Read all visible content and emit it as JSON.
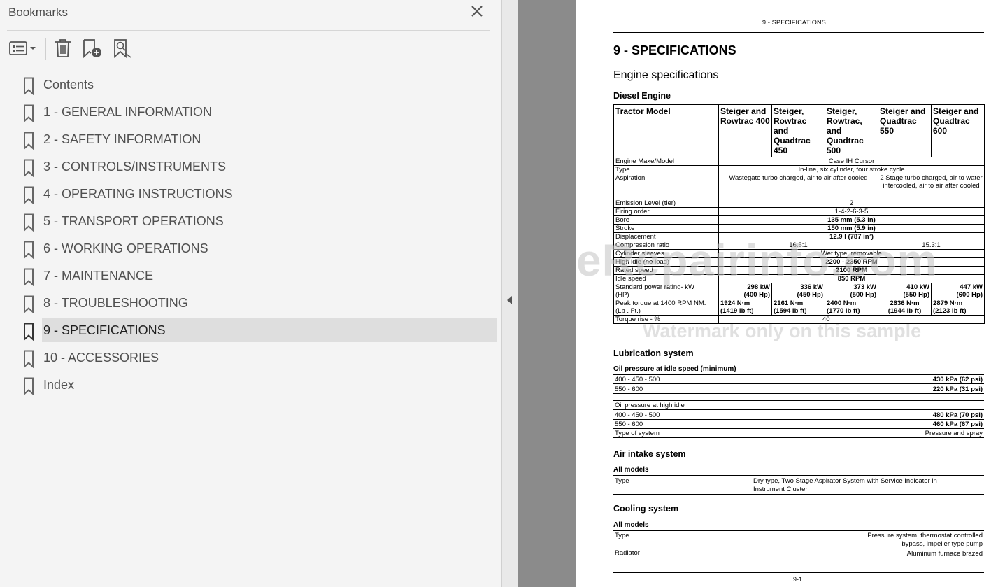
{
  "panel": {
    "title": "Bookmarks",
    "toolbar": [
      "options-menu",
      "delete-bookmark",
      "new-bookmark",
      "find-current-bookmark"
    ],
    "items": [
      {
        "label": "Contents"
      },
      {
        "label": "1 - GENERAL INFORMATION"
      },
      {
        "label": "2 - SAFETY INFORMATION"
      },
      {
        "label": "3 - CONTROLS/INSTRUMENTS"
      },
      {
        "label": "4 - OPERATING INSTRUCTIONS"
      },
      {
        "label": "5 - TRANSPORT OPERATIONS"
      },
      {
        "label": "6 - WORKING OPERATIONS"
      },
      {
        "label": "7 - MAINTENANCE"
      },
      {
        "label": "8 - TROUBLESHOOTING"
      },
      {
        "label": "9 - SPECIFICATIONS",
        "selected": true
      },
      {
        "label": "10 - ACCESSORIES"
      },
      {
        "label": "Index"
      }
    ]
  },
  "page": {
    "running_head": "9 - SPECIFICATIONS",
    "chapter_title": "9 - SPECIFICATIONS",
    "subtitle": "Engine specifications",
    "diesel": {
      "heading": "Diesel Engine",
      "header": [
        "Tractor Model",
        "Steiger and Rowtrac 400",
        "Steiger, Rowtrac and Quadtrac 450",
        "Steiger, Rowtrac, and Quadtrac 500",
        "Steiger and Quadtrac 550",
        "Steiger and Quadtrac 600"
      ],
      "engine_make": [
        "Engine Make/Model",
        "Case IH Cursor"
      ],
      "type": [
        "Type",
        "In-line, six cylinder, four stroke cycle"
      ],
      "aspiration": [
        "Aspiration",
        "Wastegate turbo charged, air to air after cooled",
        "2 Stage turbo charged, air to water intercooled, air to air after cooled"
      ],
      "emission": [
        "Emission Level (tier)",
        "2"
      ],
      "firing": [
        "Firing order",
        "1-4-2-6-3-5"
      ],
      "bore": [
        "Bore",
        "135 mm (5.3 in)"
      ],
      "stroke": [
        "Stroke",
        "150 mm (5.9 in)"
      ],
      "displacement": [
        "Displacement",
        "12.9 l (787 in³)"
      ],
      "compression": [
        "Compression ratio",
        "16.5:1",
        "15.3:1"
      ],
      "sleeves": [
        "Cylinder sleeves",
        "Wet type, removable"
      ],
      "high_idle": [
        "High idle (no load)",
        "2200 - 2350 RPM"
      ],
      "rated": [
        "Rated speed",
        "2100 RPM"
      ],
      "idle": [
        "Idle speed",
        "850 RPM"
      ],
      "power_label": [
        "Standard power rating- kW",
        "(HP)"
      ],
      "power": [
        [
          "298 kW",
          "(400 Hp)"
        ],
        [
          "336 kW",
          "(450 Hp)"
        ],
        [
          "373 kW",
          "(500 Hp)"
        ],
        [
          "410 kW",
          "(550 Hp)"
        ],
        [
          "447 kW",
          "(600 Hp)"
        ]
      ],
      "torque_label": [
        "Peak torque at 1400 RPM NM.",
        "(Lb . Ft.)"
      ],
      "torque": [
        [
          "1924 N·m",
          "(1419 lb ft)"
        ],
        [
          "2161 N·m",
          "(1594 lb ft)"
        ],
        [
          "2400 N·m",
          "(1770 lb ft)"
        ],
        [
          "2636 N·m",
          "(1944 lb ft)"
        ],
        [
          "2879 N·m",
          "(2123 lb ft)"
        ]
      ],
      "torque_rise": [
        "Torque rise - %",
        "40"
      ]
    },
    "lubrication": {
      "heading": "Lubrication system",
      "sub": "Oil pressure at idle speed (minimum)",
      "idle_rows": [
        [
          "400 - 450 - 500",
          "430 kPa (62 psi)"
        ],
        [
          "550 - 600",
          "220 kPa (31 psi)"
        ]
      ],
      "high_idle_label": "Oil pressure at high idle",
      "high_rows": [
        [
          "400 - 450 - 500",
          "480 kPa (70 psi)"
        ],
        [
          "550 - 600",
          "460 kPa (67 psi)"
        ]
      ],
      "type_row": [
        "Type of system",
        "Pressure and spray"
      ]
    },
    "air_intake": {
      "heading": "Air intake system",
      "sub": "All models",
      "label": "Type",
      "value_line1": "Dry type, Two Stage Aspirator System with Service Indicator in",
      "value_line2": "Instrument Cluster"
    },
    "cooling": {
      "heading": "Cooling system",
      "sub": "All models",
      "type_label": "Type",
      "type_line1": "Pressure system, thermostat controlled",
      "type_line2": "bypass, impeller type pump",
      "radiator_label": "Radiator",
      "radiator_value": "Aluminum furnace brazed"
    },
    "watermark": "eRepairinfo.com",
    "watermark_sub": "Watermark only on this sample",
    "page_number": "9-1"
  }
}
